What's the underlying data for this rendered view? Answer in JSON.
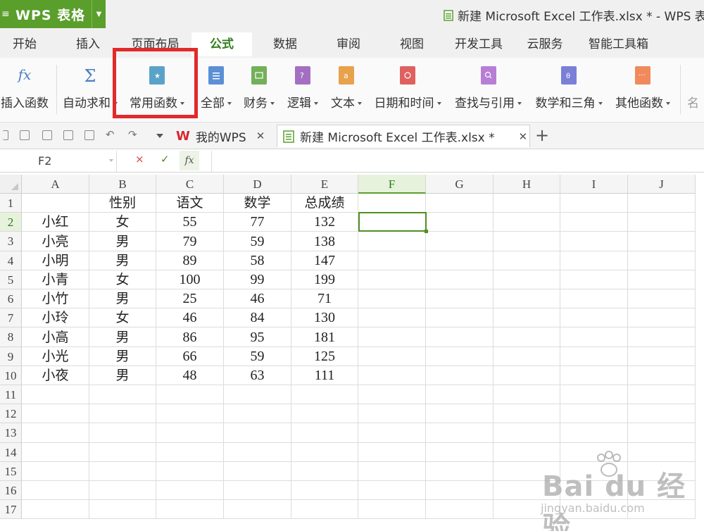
{
  "titlebar": {
    "app_name": "WPS 表格",
    "window_title": "新建 Microsoft Excel 工作表.xlsx * - WPS 表格"
  },
  "menu_tabs": [
    "开始",
    "插入",
    "页面布局",
    "公式",
    "数据",
    "审阅",
    "视图",
    "开发工具",
    "云服务",
    "智能工具箱"
  ],
  "active_menu_tab": "公式",
  "ribbon": {
    "insert_function": "插入函数",
    "autosum": "自动求和",
    "common_functions": "常用函数",
    "all": "全部",
    "financial": "财务",
    "logical": "逻辑",
    "text": "文本",
    "datetime": "日期和时间",
    "lookup": "查找与引用",
    "math": "数学和三角",
    "other": "其他函数",
    "name_mgr": "名"
  },
  "doc_tabs": {
    "my_wps": "我的WPS",
    "file": "新建 Microsoft Excel 工作表.xlsx *",
    "add": "+"
  },
  "formula_bar": {
    "name_box": "F2",
    "cancel": "×",
    "confirm": "✓",
    "fx": "fx",
    "content": ""
  },
  "columns": [
    "A",
    "B",
    "C",
    "D",
    "E",
    "F",
    "G",
    "H",
    "I",
    "J"
  ],
  "selected_column": "F",
  "rows": [
    "1",
    "2",
    "3",
    "4",
    "5",
    "6",
    "7",
    "8",
    "9",
    "10",
    "11",
    "12",
    "13",
    "14",
    "15",
    "16",
    "17"
  ],
  "selected_row": "2",
  "table": {
    "header": [
      "",
      "性别",
      "语文",
      "数学",
      "总成绩"
    ],
    "body": [
      [
        "小红",
        "女",
        "55",
        "77",
        "132"
      ],
      [
        "小亮",
        "男",
        "79",
        "59",
        "138"
      ],
      [
        "小明",
        "男",
        "89",
        "58",
        "147"
      ],
      [
        "小青",
        "女",
        "100",
        "99",
        "199"
      ],
      [
        "小竹",
        "男",
        "25",
        "46",
        "71"
      ],
      [
        "小玲",
        "女",
        "46",
        "84",
        "130"
      ],
      [
        "小高",
        "男",
        "86",
        "95",
        "181"
      ],
      [
        "小光",
        "男",
        "66",
        "59",
        "125"
      ],
      [
        "小夜",
        "男",
        "48",
        "63",
        "111"
      ]
    ]
  },
  "watermark": {
    "line1": "Bai du 经验",
    "line2": "jingyan.baidu.com"
  },
  "colors": {
    "brand_green": "#5a9e2c",
    "highlight_red": "#e12a2a",
    "selection_green": "#4f8f22"
  }
}
